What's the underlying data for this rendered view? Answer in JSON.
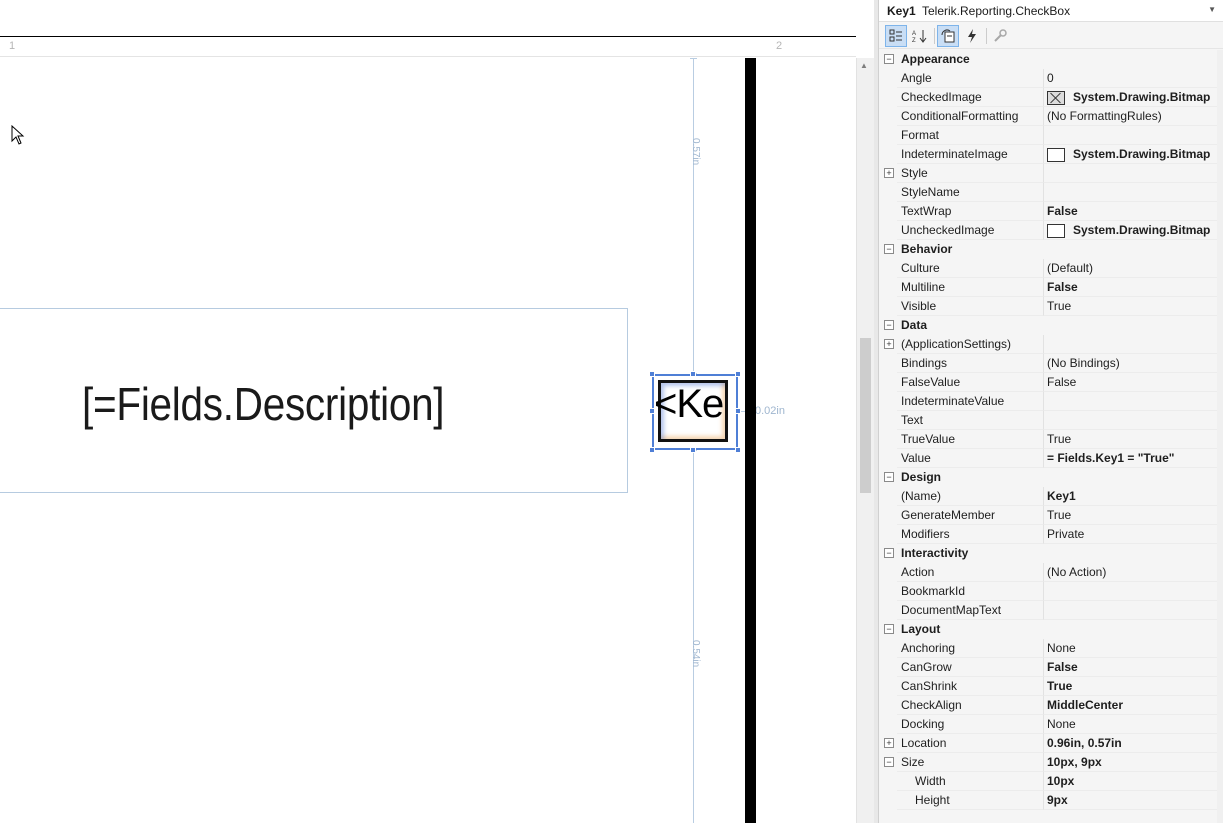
{
  "ruler": {
    "mark1": "1",
    "mark2": "2"
  },
  "designer": {
    "description_field": "[=Fields.Description]",
    "checkbox_text": "<Ke",
    "guide_top_label": "0.57in",
    "guide_bottom_label": "0.54in",
    "guide_right_label": "0.02in"
  },
  "property_panel": {
    "object_name": "Key1",
    "object_type": "Telerik.Reporting.CheckBox",
    "toolbar": [
      "categorized-icon",
      "alphabetical-icon",
      "properties-icon",
      "events-icon",
      "property-pages-icon"
    ],
    "rows": [
      {
        "kind": "cat",
        "name": "Appearance"
      },
      {
        "name": "Angle",
        "value": "0"
      },
      {
        "name": "CheckedImage",
        "value": "System.Drawing.Bitmap",
        "bold": true,
        "swatch": "checked"
      },
      {
        "name": "ConditionalFormatting",
        "value": "(No FormattingRules)"
      },
      {
        "name": "Format",
        "value": ""
      },
      {
        "name": "IndeterminateImage",
        "value": "System.Drawing.Bitmap",
        "bold": true,
        "swatch": "empty"
      },
      {
        "name": "Style",
        "value": "",
        "expandable": true
      },
      {
        "name": "StyleName",
        "value": ""
      },
      {
        "name": "TextWrap",
        "value": "False",
        "bold": true
      },
      {
        "name": "UncheckedImage",
        "value": "System.Drawing.Bitmap",
        "bold": true,
        "swatch": "empty"
      },
      {
        "kind": "cat",
        "name": "Behavior"
      },
      {
        "name": "Culture",
        "value": "(Default)"
      },
      {
        "name": "Multiline",
        "value": "False",
        "bold": true
      },
      {
        "name": "Visible",
        "value": "True"
      },
      {
        "kind": "cat",
        "name": "Data"
      },
      {
        "name": "(ApplicationSettings)",
        "value": "",
        "expandable": true
      },
      {
        "name": "Bindings",
        "value": "(No Bindings)"
      },
      {
        "name": "FalseValue",
        "value": "False"
      },
      {
        "name": "IndeterminateValue",
        "value": ""
      },
      {
        "name": "Text",
        "value": ""
      },
      {
        "name": "TrueValue",
        "value": "True"
      },
      {
        "name": "Value",
        "value": "= Fields.Key1 = \"True\"",
        "bold": true
      },
      {
        "kind": "cat",
        "name": "Design"
      },
      {
        "name": "(Name)",
        "value": "Key1",
        "bold": true
      },
      {
        "name": "GenerateMember",
        "value": "True"
      },
      {
        "name": "Modifiers",
        "value": "Private"
      },
      {
        "kind": "cat",
        "name": "Interactivity"
      },
      {
        "name": "Action",
        "value": "(No Action)"
      },
      {
        "name": "BookmarkId",
        "value": ""
      },
      {
        "name": "DocumentMapText",
        "value": ""
      },
      {
        "kind": "cat",
        "name": "Layout"
      },
      {
        "name": "Anchoring",
        "value": "None"
      },
      {
        "name": "CanGrow",
        "value": "False",
        "bold": true
      },
      {
        "name": "CanShrink",
        "value": "True",
        "bold": true
      },
      {
        "name": "CheckAlign",
        "value": "MiddleCenter",
        "bold": true
      },
      {
        "name": "Docking",
        "value": "None"
      },
      {
        "name": "Location",
        "value": "0.96in, 0.57in",
        "bold": true,
        "expandable": true
      },
      {
        "name": "Size",
        "value": "10px, 9px",
        "bold": true,
        "expanded": true
      },
      {
        "name": "Width",
        "value": "10px",
        "bold": true,
        "sub": true
      },
      {
        "name": "Height",
        "value": "9px",
        "bold": true,
        "sub": true
      }
    ]
  }
}
